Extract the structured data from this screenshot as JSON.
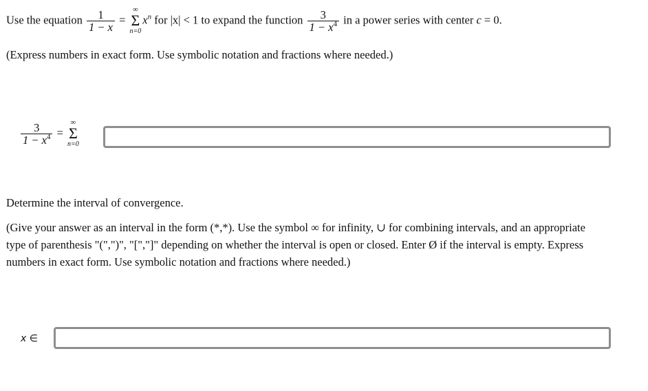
{
  "question": {
    "intro": "Use the equation",
    "eq_num": "1",
    "eq_den": "1 − x",
    "equals": "=",
    "sum_upper": "∞",
    "sum_symbol": "Σ",
    "sum_lower": "n=0",
    "term_base": "x",
    "term_exp": "n",
    "condition": "for |x| < 1 to expand the function",
    "func_num": "3",
    "func_den_base": "1 − x",
    "func_den_exp": "4",
    "tail": "in a power series with center",
    "center_var": "c",
    "center_eq": "= 0."
  },
  "instruction1": "(Express numbers in exact form. Use symbolic notation and fractions where needed.)",
  "series_answer": {
    "lhs_num": "3",
    "lhs_den_base": "1 − x",
    "lhs_den_exp": "4",
    "equals": "=",
    "sum_upper": "∞",
    "sum_symbol": "Σ",
    "sum_lower": "n=0",
    "value": ""
  },
  "interval_prompt": "Determine the interval of convergence.",
  "instruction2_lines": [
    "(Give your answer as an interval in the form (*,*). Use the symbol ∞ for infinity, ∪ for combining intervals, and an appropriate",
    "type of parenthesis \"(\",\")\", \"[\",\"]\" depending on whether the interval is open or closed. Enter Ø if the interval is empty. Express",
    "numbers in exact form. Use symbolic notation and fractions where needed.)"
  ],
  "interval_answer": {
    "label": "x ∈",
    "value": ""
  }
}
